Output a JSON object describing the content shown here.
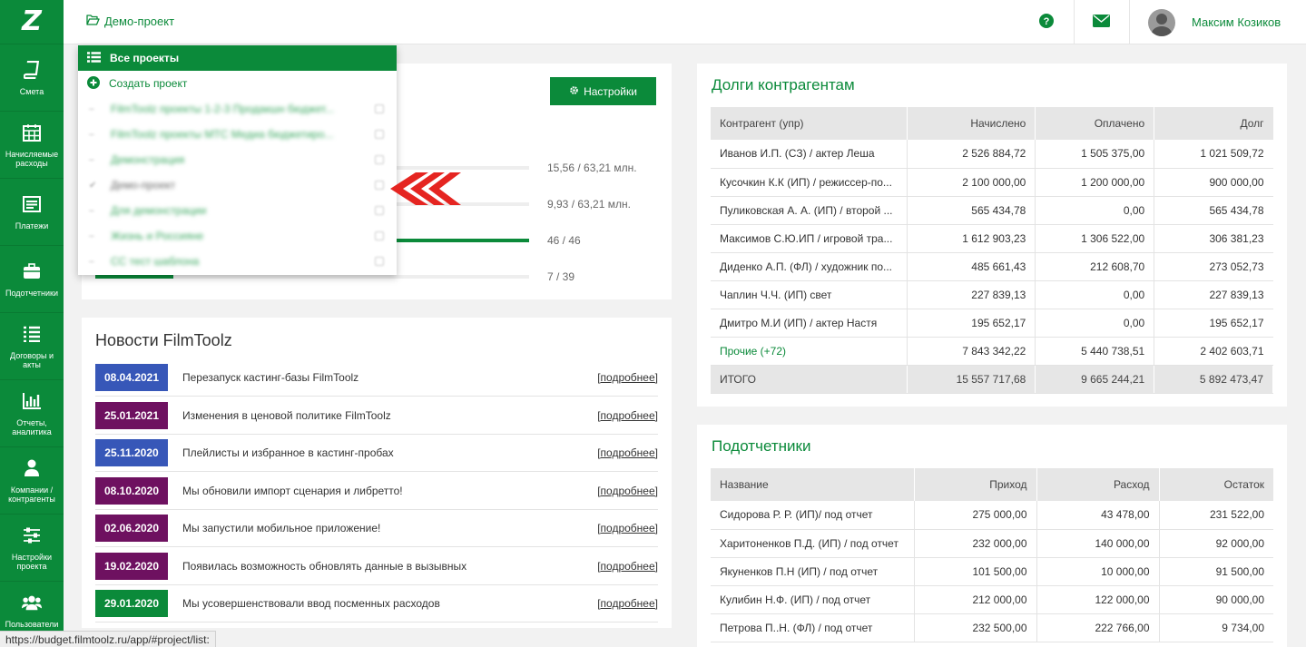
{
  "colors": {
    "brand": "#0b8a3a",
    "date_blue": "#3757b8",
    "date_purple": "#6e1160",
    "date_green": "#0b8a3a",
    "arrow": "#e52521"
  },
  "sidebar": {
    "logo": "Z",
    "items": [
      {
        "label": "Смета",
        "icon": "book-icon"
      },
      {
        "label": "Начисляемые расходы",
        "icon": "calendar-icon"
      },
      {
        "label": "Платежи",
        "icon": "payments-icon"
      },
      {
        "label": "Подотчетники",
        "icon": "briefcase-icon"
      },
      {
        "label": "Договоры и акты",
        "icon": "list-icon"
      },
      {
        "label": "Отчеты, аналитика",
        "icon": "bar-chart-icon"
      },
      {
        "label": "Компании / контрагенты",
        "icon": "user-icon"
      },
      {
        "label": "Настройки проекта",
        "icon": "sliders-icon"
      },
      {
        "label": "Пользователи и",
        "icon": "users-icon"
      }
    ]
  },
  "header": {
    "project": "Демо-проект",
    "user_name": "Максим Козиков"
  },
  "dropdown": {
    "all_projects": "Все проекты",
    "create_project": "Создать проект",
    "projects": [
      {
        "name": "FilmToolz проекты 1-2-3 Продакшн бюджет..."
      },
      {
        "name": "FilmToolz проекты МТС Медиа бюджетиро..."
      },
      {
        "name": "Демонстрация"
      },
      {
        "name": "Демо-проект",
        "current": true
      },
      {
        "name": "Для демонстрации"
      },
      {
        "name": "Жизнь и Россияне"
      },
      {
        "name": "СС тест шаблона"
      }
    ]
  },
  "budget_panel": {
    "settings_label": "Настройки",
    "progress": [
      {
        "text": "15,56 / 63,21 млн.",
        "fraction": 0.246
      },
      {
        "text": "9,93 / 63,21 млн.",
        "fraction": 0.157
      },
      {
        "text": "46 / 46",
        "fraction": 1.0
      },
      {
        "text": "7 / 39",
        "fraction": 0.179
      }
    ]
  },
  "news": {
    "title": "Новости FilmToolz",
    "more_label": "подробнее",
    "items": [
      {
        "date": "08.04.2021",
        "text": "Перезапуск кастинг-базы FilmToolz",
        "color": "blue"
      },
      {
        "date": "25.01.2021",
        "text": "Изменения в ценовой политике FilmToolz",
        "color": "purple"
      },
      {
        "date": "25.11.2020",
        "text": "Плейлисты и избранное в кастинг-пробах",
        "color": "blue"
      },
      {
        "date": "08.10.2020",
        "text": "Мы обновили импорт сценария и либретто!",
        "color": "purple"
      },
      {
        "date": "02.06.2020",
        "text": "Мы запустили мобильное приложение!",
        "color": "purple"
      },
      {
        "date": "19.02.2020",
        "text": "Появилась возможность обновлять данные в вызывных",
        "color": "purple"
      },
      {
        "date": "29.01.2020",
        "text": "Мы усовершенствовали ввод посменных расходов",
        "color": "green"
      }
    ]
  },
  "debts": {
    "title": "Долги контрагентам",
    "columns": [
      "Контрагент (упр)",
      "Начислено",
      "Оплачено",
      "Долг"
    ],
    "rows": [
      [
        "Иванов И.П. (СЗ) / актер Леша",
        "2 526 884,72",
        "1 505 375,00",
        "1 021 509,72"
      ],
      [
        "Кусочкин К.К (ИП) / режиссер-по...",
        "2 100 000,00",
        "1 200 000,00",
        "900 000,00"
      ],
      [
        "Пуликовская А. А. (ИП) / второй ...",
        "565 434,78",
        "0,00",
        "565 434,78"
      ],
      [
        "Максимов С.Ю.ИП / игровой тра...",
        "1 612 903,23",
        "1 306 522,00",
        "306 381,23"
      ],
      [
        "Диденко А.П. (ФЛ) / художник по...",
        "485 661,43",
        "212 608,70",
        "273 052,73"
      ],
      [
        "Чаплин Ч.Ч. (ИП) свет",
        "227 839,13",
        "0,00",
        "227 839,13"
      ],
      [
        "Дмитро М.И (ИП) / актер Настя",
        "195 652,17",
        "0,00",
        "195 652,17"
      ]
    ],
    "other": [
      "Прочие (+72)",
      "7 843 342,22",
      "5 440 738,51",
      "2 402 603,71"
    ],
    "total": [
      "ИТОГО",
      "15 557 717,68",
      "9 665 244,21",
      "5 892 473,47"
    ]
  },
  "accountables": {
    "title": "Подотчетники",
    "columns": [
      "Название",
      "Приход",
      "Расход",
      "Остаток"
    ],
    "rows": [
      [
        "Сидорова Р. Р. (ИП)/ под отчет",
        "275 000,00",
        "43 478,00",
        "231 522,00"
      ],
      [
        "Харитоненков П.Д. (ИП) / под отчет",
        "232 000,00",
        "140 000,00",
        "92 000,00"
      ],
      [
        "Якуненков П.Н (ИП) / под отчет",
        "101 500,00",
        "10 000,00",
        "91 500,00"
      ],
      [
        "Кулибин Н.Ф. (ИП) / под отчет",
        "212 000,00",
        "122 000,00",
        "90 000,00"
      ],
      [
        "Петрова П..Н. (ФЛ) / под отчет",
        "232 500,00",
        "222 766,00",
        "9 734,00"
      ]
    ]
  },
  "status_url": "https://budget.filmtoolz.ru/app/#project/list:"
}
